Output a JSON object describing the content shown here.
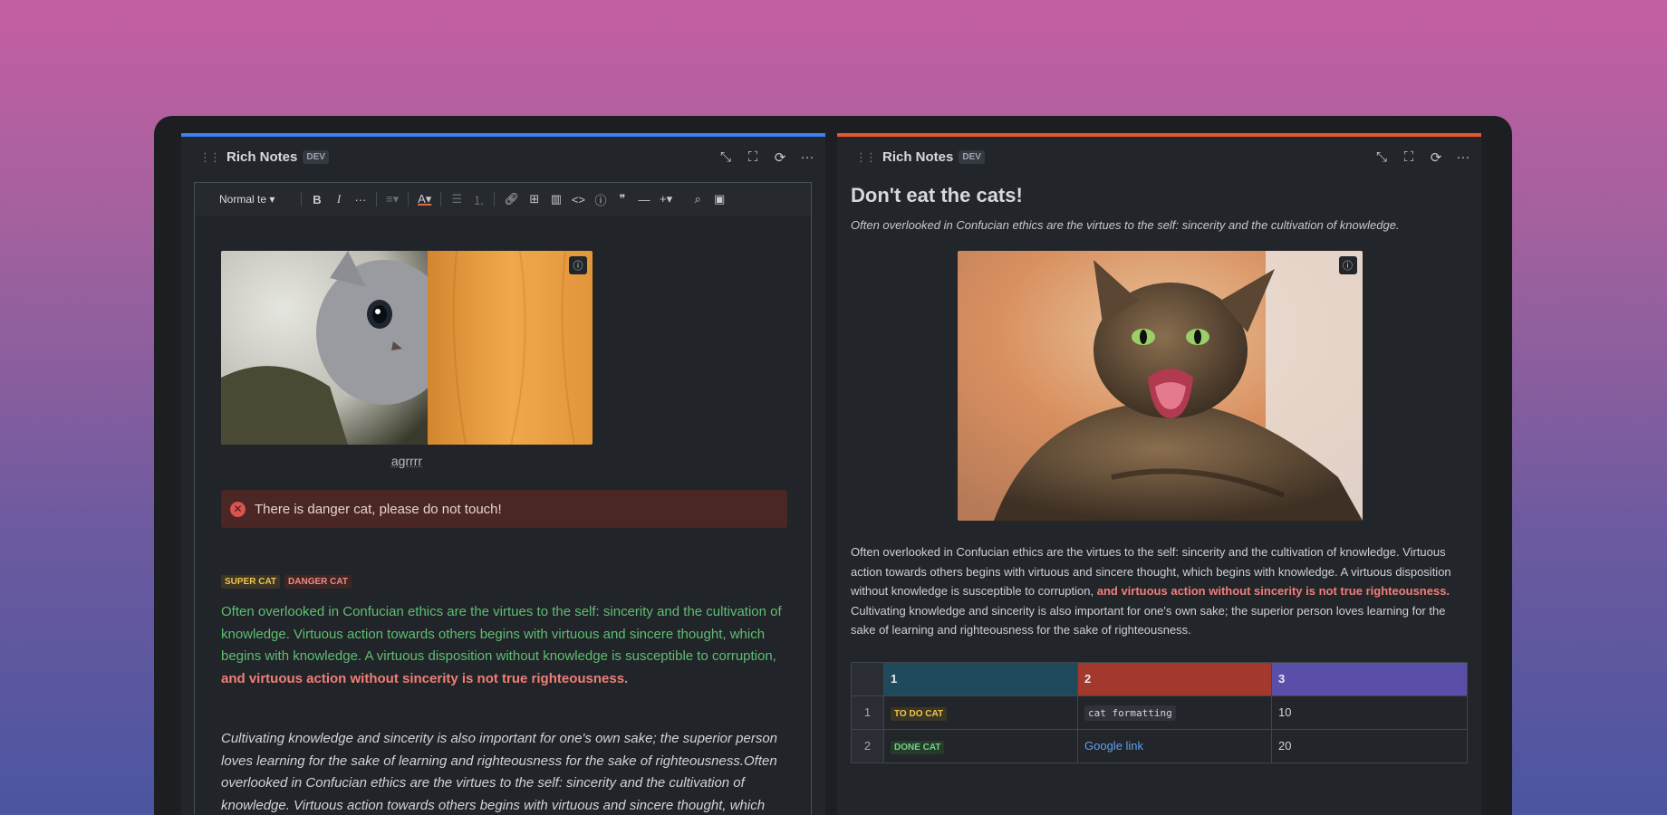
{
  "left": {
    "accent": "#3b82f6",
    "header": {
      "title": "Rich Notes",
      "badge": "DEV"
    },
    "toolbar": {
      "block_style": "Normal te",
      "bold": "B",
      "italic": "I",
      "more": "···"
    },
    "image_caption": "agrrrr",
    "danger_callout": "There is danger cat, please do not touch!",
    "badges": [
      "SUPER CAT",
      "DANGER CAT"
    ],
    "green_paragraph": "Often overlooked in Confucian ethics are the virtues to the self: sincerity and the cultivation of knowledge. Virtuous action towards others begins with virtuous and sincere thought, which begins with knowledge. A virtuous disposition without knowledge is susceptible to corruption,",
    "strong_text": "and virtuous action without sincerity is not true righteousness.",
    "italic_paragraph": "Cultivating knowledge and sincerity is also important for one's own sake; the superior person loves learning for the sake of learning and righteousness for the sake of righteousness.Often overlooked in Confucian ethics are the virtues to the self: sincerity and the cultivation of knowledge. Virtuous action towards others begins with virtuous and sincere thought, which"
  },
  "right": {
    "accent": "#e8572e",
    "header": {
      "title": "Rich Notes",
      "badge": "DEV"
    },
    "title": "Don't eat the cats!",
    "subtitle": "Often overlooked in Confucian ethics are the virtues to the self: sincerity and the cultivation of knowledge.",
    "paragraph": "Often overlooked in Confucian ethics are the virtues to the self: sincerity and the cultivation of knowledge. Virtuous action towards others begins with virtuous and sincere thought, which begins with knowledge. A virtuous disposition without knowledge is susceptible to corruption,",
    "strong_text": "and virtuous action without sincerity is not true righteousness.",
    "paragraph_end": "Cultivating knowledge and sincerity is also important for one's own sake; the superior person loves learning for the sake of learning and righteousness for the sake of righteousness.",
    "table": {
      "headers": [
        "1",
        "2",
        "3"
      ],
      "header_colors": [
        "#1f4a5c",
        "#a3392d",
        "#5a4fa8"
      ],
      "rows": [
        {
          "num": "1",
          "badge": "TO DO CAT",
          "code": "cat formatting",
          "value": "10"
        },
        {
          "num": "2",
          "badge": "DONE CAT",
          "link": "Google link",
          "value": "20"
        }
      ]
    }
  }
}
